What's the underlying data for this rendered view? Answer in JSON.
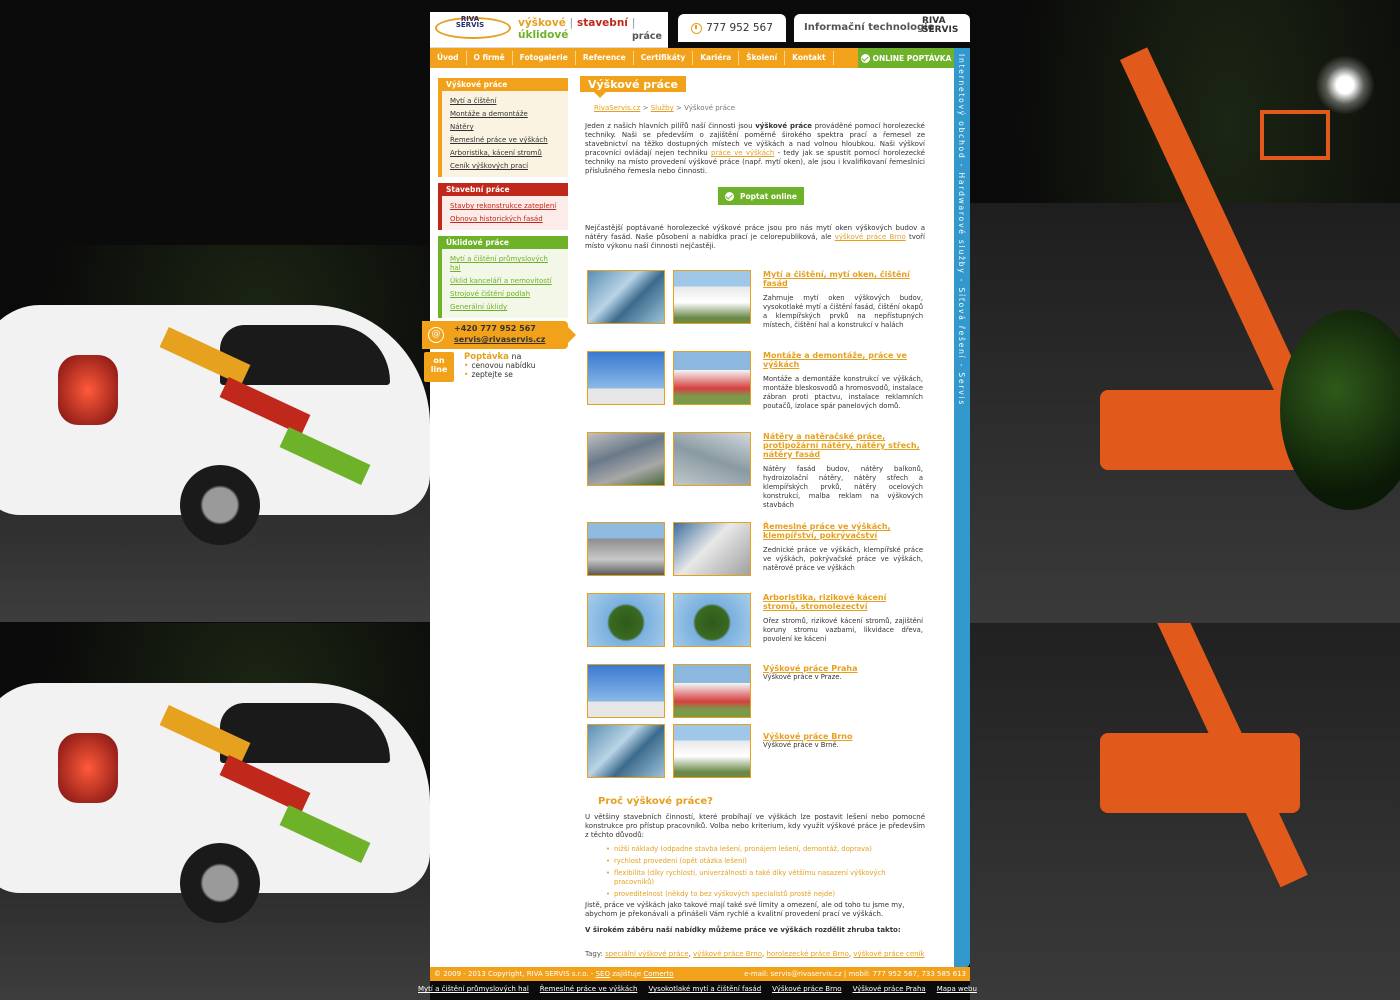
{
  "header": {
    "logo_text": "RIVA SERVIS",
    "tagline_1": "výškové",
    "tagline_2": "stavební",
    "tagline_3": "úklidové",
    "tagline_sub": "práce",
    "phone": "777 952 567",
    "it_label": "Informační technologie",
    "it_logo_1": "RIVA",
    "it_logo_2": "SERVIS"
  },
  "nav": {
    "items": [
      "Úvod",
      "O firmě",
      "Fotogalerie",
      "Reference",
      "Certifikáty",
      "Kariéra",
      "Školení",
      "Kontakt"
    ],
    "online": "ONLINE POPTÁVKA"
  },
  "vertical_bar": "Internetový obchod - Hardwarové služby - Síťová řešení - Servis",
  "sidebar": {
    "groups": [
      {
        "title": "Výškové práce",
        "items": [
          "Mytí a čištění",
          "Montáže a demontáže",
          "Nátěry",
          "Řemeslné práce ve výškách",
          "Arboristika, kácení stromů",
          "Ceník výškových prací"
        ]
      },
      {
        "title": "Stavební práce",
        "items": [
          "Stavby rekonstrukce zateplení",
          "Obnova historických fasád"
        ]
      },
      {
        "title": "Úklidové práce",
        "items": [
          "Mytí a čištění průmyslových hal",
          "Úklid kanceláří a nemovitostí",
          "Strojové čištění podlah",
          "Generální úklidy"
        ]
      }
    ],
    "contact_phone": "+420 777 952 567",
    "contact_email": "servis@rivaservis.cz",
    "online_tag_1": "on",
    "online_tag_2": "line",
    "poptavka_title": "Poptávka",
    "poptavka_suffix": "na",
    "poptavka_items": [
      "cenovou nabídku",
      "zeptejte se"
    ]
  },
  "main": {
    "title": "Výškové práce",
    "breadcrumb": [
      "RivaServis.cz",
      "Služby",
      "Výškové práce"
    ],
    "intro_1": "Jeden z našich hlavních pilířů naší činnosti jsou",
    "intro_bold": "výškové práce",
    "intro_2": "prováděné pomocí horolezecké techniky. Naši se především o zajištění poměrně širokého spektra prací a řemesel ze stavebnictví na těžko dostupných místech ve výškách a nad volnou hloubkou. Naši výškoví pracovníci ovládají nejen techniku",
    "intro_link": "práce ve výškách",
    "intro_3": "- tedy jak se spustit pomocí horolezecké techniky na místo provedení výškové práce (např. mytí oken), ale jsou i kvalifikovaní řemeslníci příslušného řemesla nebo činnosti.",
    "poptat_btn": "Poptat online",
    "intro2_1": "Nejčastější poptávané horolezecké výškové práce jsou pro nás mytí oken výškových budov a nátěry fasád. Naše působení a nabídka prací je celorepubliková, ale",
    "intro2_link": "výškové práce Brno",
    "intro2_2": "tvoří místo výkonu naší činnosti nejčastěji.",
    "services": [
      {
        "title": "Mytí a čištění, mytí oken, čištění fasád",
        "desc": "Zahrnuje mytí oken výškových budov, vysokotlaké mytí a čištění fasád, čištění okapů a klempířských prvků na nepřístupných místech, čištění hal a konstrukcí v halách"
      },
      {
        "title": "Montáže a demontáže, práce ve výškách",
        "desc": "Montáže a demontáže konstrukcí ve výškách, montáže bleskosvodů a hromosvodů, instalace zábran proti ptactvu, instalace reklamních poutačů, izolace spár panelových domů."
      },
      {
        "title": "Nátěry a natěračské práce, protipožární nátěry, nátěry střech, nátěry fasád",
        "desc": "Nátěry fasád budov, nátěry balkonů, hydroizolační nátěry, nátěry střech a klempířských prvků, nátěry ocelových konstrukcí, malba reklam na výškových stavbách"
      },
      {
        "title": "Řemeslné práce ve výškách, klempířství, pokrývačství",
        "desc": "Zednické práce ve výškách, klempířské práce ve výškách, pokrývačské práce ve výškách, natěrové práce ve výškách"
      },
      {
        "title": "Arboristika, rizikové kácení stromů, stromolezectví",
        "desc": "Ořez stromů, rizikové kácení stromů, zajištění koruny stromu vazbami, likvidace dřeva, povolení ke kácení"
      },
      {
        "title": "Výškové práce Praha",
        "desc": "Výškové práce v Praze."
      },
      {
        "title": "Výškové práce Brno",
        "desc": "Výškové práce v Brně."
      }
    ],
    "why_title": "Proč výškové práce?",
    "why_text": "U většiny stavebních činností, které probíhají ve výškách lze postavit lešení nebo pomocné konstrukce pro přístup pracovníků. Volba nebo kriterium, kdy využít výškové práce je především z těchto důvodů:",
    "why_list": [
      "nižší náklady (odpadne stavba lešení, pronájem lešení, demontáž, doprava)",
      "rychlost provedení (opět otázka lešení)",
      "flexibilita (díky rychlosti, univerzálnosti a také díky většímu nasazení výškových pracovníků)",
      "proveditelnost (někdy to bez výškových specialistů prostě nejde)"
    ],
    "why_text2": "Jistě, práce ve výškách jako takové mají také své limity a omezení, ale od toho tu jsme my, abychom je překonávali a přinášeli Vám rychlé a kvalitní provedení prací ve výškách.",
    "why_bold": "V širokém záběru naší nabídky můžeme práce ve výškách rozdělit zhruba takto:",
    "tags_label": "Tagy:",
    "tags": [
      "speciální výškové práce",
      "výškové práce Brno",
      "horolezecké práce Brno",
      "výškové práce ceník"
    ]
  },
  "footer": {
    "copyright": "© 2009 - 2013 Copyright, RIVA SERVIS s.r.o. -",
    "seo_link": "SEO",
    "seo_text": "zajišťuje",
    "comerto": "Comerto",
    "contact": "e-mail: servis@rivaservis.cz | mobil: 777 952 567, 733 585 613"
  },
  "footer_links": [
    "Mytí a čištění průmyslových hal",
    "Řemeslné práce ve výškách",
    "Vysokotlaké mytí a čištění fasád",
    "Výškové práce Brno",
    "Výškové práce Praha",
    "Mapa webu"
  ]
}
